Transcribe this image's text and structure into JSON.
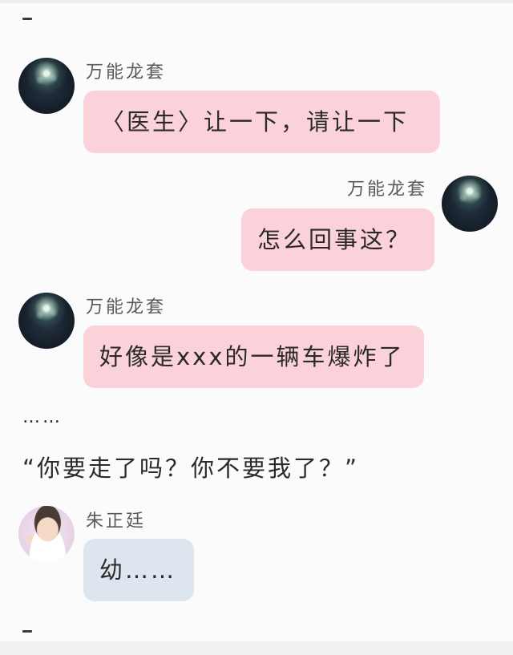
{
  "chat": {
    "messages": [
      {
        "sender": "万能龙套",
        "text": "〈医生〉让一下，请让一下",
        "side": "left"
      },
      {
        "sender": "万能龙套",
        "text": "怎么回事这？",
        "side": "right"
      },
      {
        "sender": "万能龙套",
        "text": "好像是xxx的一辆车爆炸了",
        "side": "left"
      },
      {
        "sender": "朱正廷",
        "text": "幼……",
        "side": "left"
      }
    ],
    "narration": [
      "……",
      "“你要走了吗？你不要我了？”"
    ]
  }
}
